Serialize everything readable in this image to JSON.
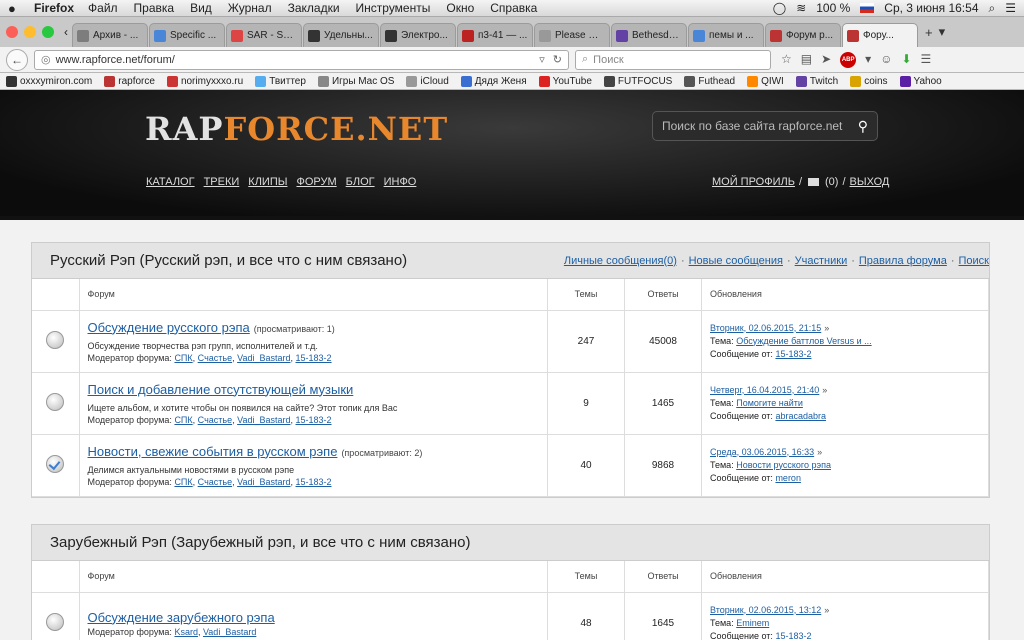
{
  "menubar": {
    "app": "Firefox",
    "items": [
      "Файл",
      "Правка",
      "Вид",
      "Журнал",
      "Закладки",
      "Инструменты",
      "Окно",
      "Справка"
    ],
    "battery": "100 %",
    "clock": "Ср, 3 июня  16:54"
  },
  "tabs": [
    {
      "label": "Архив - ...",
      "color": "#7d7d7d"
    },
    {
      "label": "Specific ...",
      "color": "#4a86d8"
    },
    {
      "label": "SAR - Specifi...",
      "color": "#d44"
    },
    {
      "label": "Удельны...",
      "color": "#333"
    },
    {
      "label": "Электро...",
      "color": "#333"
    },
    {
      "label": "п3-41 — ...",
      "color": "#b22"
    },
    {
      "label": "Please St...",
      "color": "#999"
    },
    {
      "label": "Bethesda...",
      "color": "#6441a5"
    },
    {
      "label": "пемы и ...",
      "color": "#4a86d8"
    },
    {
      "label": "Форум р...",
      "color": "#b33"
    },
    {
      "label": "Фору...",
      "color": "#b33",
      "active": true
    }
  ],
  "urlbar": {
    "url": "www.rapforce.net/forum/",
    "search_placeholder": "Поиск"
  },
  "bookmarks": [
    {
      "label": "oxxxymiron.com",
      "color": "#333"
    },
    {
      "label": "rapforce",
      "color": "#b33"
    },
    {
      "label": "norimyxxxo.ru",
      "color": "#c33"
    },
    {
      "label": "Твиттер",
      "color": "#55acee"
    },
    {
      "label": "Игры Mac OS",
      "color": "#888"
    },
    {
      "label": "iCloud",
      "color": "#999"
    },
    {
      "label": "Дядя Женя",
      "color": "#3a6ed0"
    },
    {
      "label": "YouTube",
      "color": "#d22"
    },
    {
      "label": "FUTFOCUS",
      "color": "#444"
    },
    {
      "label": "Futhead",
      "color": "#555"
    },
    {
      "label": "QIWI",
      "color": "#f80"
    },
    {
      "label": "Twitch",
      "color": "#6441a5"
    },
    {
      "label": "coins",
      "color": "#d9a300"
    },
    {
      "label": "Yahoo",
      "color": "#5b1fa6"
    }
  ],
  "site": {
    "logo_a": "RAP",
    "logo_b": "FORCE.NET",
    "search_placeholder": "Поиск по базе сайта rapforce.net",
    "nav": [
      "КАТАЛОГ",
      "ТРЕКИ",
      "КЛИПЫ",
      "ФОРУМ",
      "БЛОГ",
      "ИНФО"
    ],
    "profile": "МОЙ ПРОФИЛЬ",
    "slash": "/",
    "mail_count": "(0)",
    "logout": "ВЫХОД"
  },
  "section_links": [
    "Личные сообщения(0)",
    "Новые сообщения",
    "Участники",
    "Правила форума",
    "Поиск"
  ],
  "columns": {
    "forum": "Форум",
    "topics": "Темы",
    "answers": "Ответы",
    "updates": "Обновления"
  },
  "sections": [
    {
      "title": "Русский Рэп (Русский рэп, и все что с ним связано)",
      "forums": [
        {
          "title": "Обсуждение русского рэпа",
          "viewers": "(просматривают: 1)",
          "desc": "Обсуждение творчества рэп групп, исполнителей и т.д.",
          "mod_label": "Модератор форума:",
          "mods": [
            "СПК",
            "Счастье",
            "Vadi_Bastard",
            "15-183-2"
          ],
          "topics": "247",
          "answers": "45008",
          "date": "Вторник, 02.06.2015, 21:15",
          "topic_label": "Тема:",
          "topic": "Обсуждение баттлов Versus и ...",
          "from_label": "Сообщение от:",
          "from": "15-183-2",
          "checked": false
        },
        {
          "title": "Поиск и добавление отсутствующей музыки",
          "viewers": "",
          "desc": "Ищете альбом, и хотите чтобы он появился на сайте? Этот топик для Вас",
          "mod_label": "Модератор форума:",
          "mods": [
            "СПК",
            "Счастье",
            "Vadi_Bastard",
            "15-183-2"
          ],
          "topics": "9",
          "answers": "1465",
          "date": "Четверг, 16.04.2015, 21:40",
          "topic_label": "Тема:",
          "topic": "Помогите найти",
          "from_label": "Сообщение от:",
          "from": "abracadabra",
          "checked": false
        },
        {
          "title": "Новости, свежие события в русском рэпе",
          "viewers": "(просматривают: 2)",
          "desc": "Делимся актуальными новостями в русском рэпе",
          "mod_label": "Модератор форума:",
          "mods": [
            "СПК",
            "Счастье",
            "Vadi_Bastard",
            "15-183-2"
          ],
          "topics": "40",
          "answers": "9868",
          "date": "Среда, 03.06.2015, 16:33",
          "topic_label": "Тема:",
          "topic": "Новости русского рэпа",
          "from_label": "Сообщение от:",
          "from": "meron",
          "checked": true
        }
      ]
    },
    {
      "title": "Зарубежный Рэп (Зарубежный рэп, и все что с ним связано)",
      "forums": [
        {
          "title": "Обсуждение зарубежного рэпа",
          "viewers": "",
          "desc": "",
          "mod_label": "Модератор форума:",
          "mods": [
            "Ksard",
            "Vadi_Bastard"
          ],
          "topics": "48",
          "answers": "1645",
          "date": "Вторник, 02.06.2015, 13:12",
          "topic_label": "Тема:",
          "topic": "Eminem",
          "from_label": "Сообщение от:",
          "from": "15-183-2",
          "checked": false
        }
      ]
    }
  ]
}
